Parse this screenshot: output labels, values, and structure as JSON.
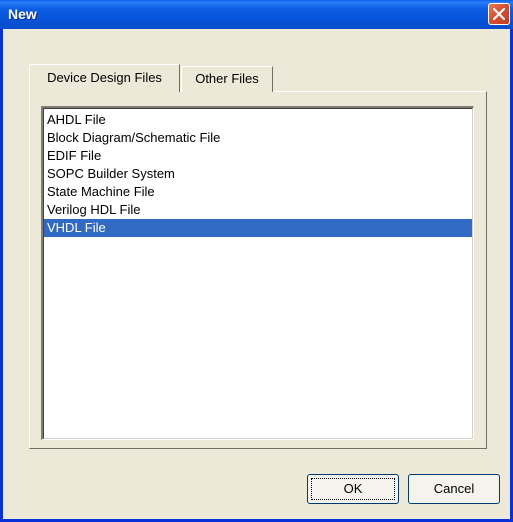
{
  "window": {
    "title": "New"
  },
  "tabs": [
    {
      "label": "Device Design Files",
      "active": true
    },
    {
      "label": "Other Files",
      "active": false
    }
  ],
  "file_list": {
    "items": [
      {
        "label": "AHDL File",
        "selected": false
      },
      {
        "label": "Block Diagram/Schematic File",
        "selected": false
      },
      {
        "label": "EDIF File",
        "selected": false
      },
      {
        "label": "SOPC Builder System",
        "selected": false
      },
      {
        "label": "State Machine File",
        "selected": false
      },
      {
        "label": "Verilog HDL File",
        "selected": false
      },
      {
        "label": "VHDL File",
        "selected": true
      }
    ]
  },
  "buttons": {
    "ok_label": "OK",
    "cancel_label": "Cancel"
  },
  "colors": {
    "titlebar": "#0553d8",
    "selection": "#316ac5",
    "dialog_bg": "#ece9d8",
    "close_button": "#d8502e"
  },
  "icons": {
    "close": "close-icon"
  }
}
